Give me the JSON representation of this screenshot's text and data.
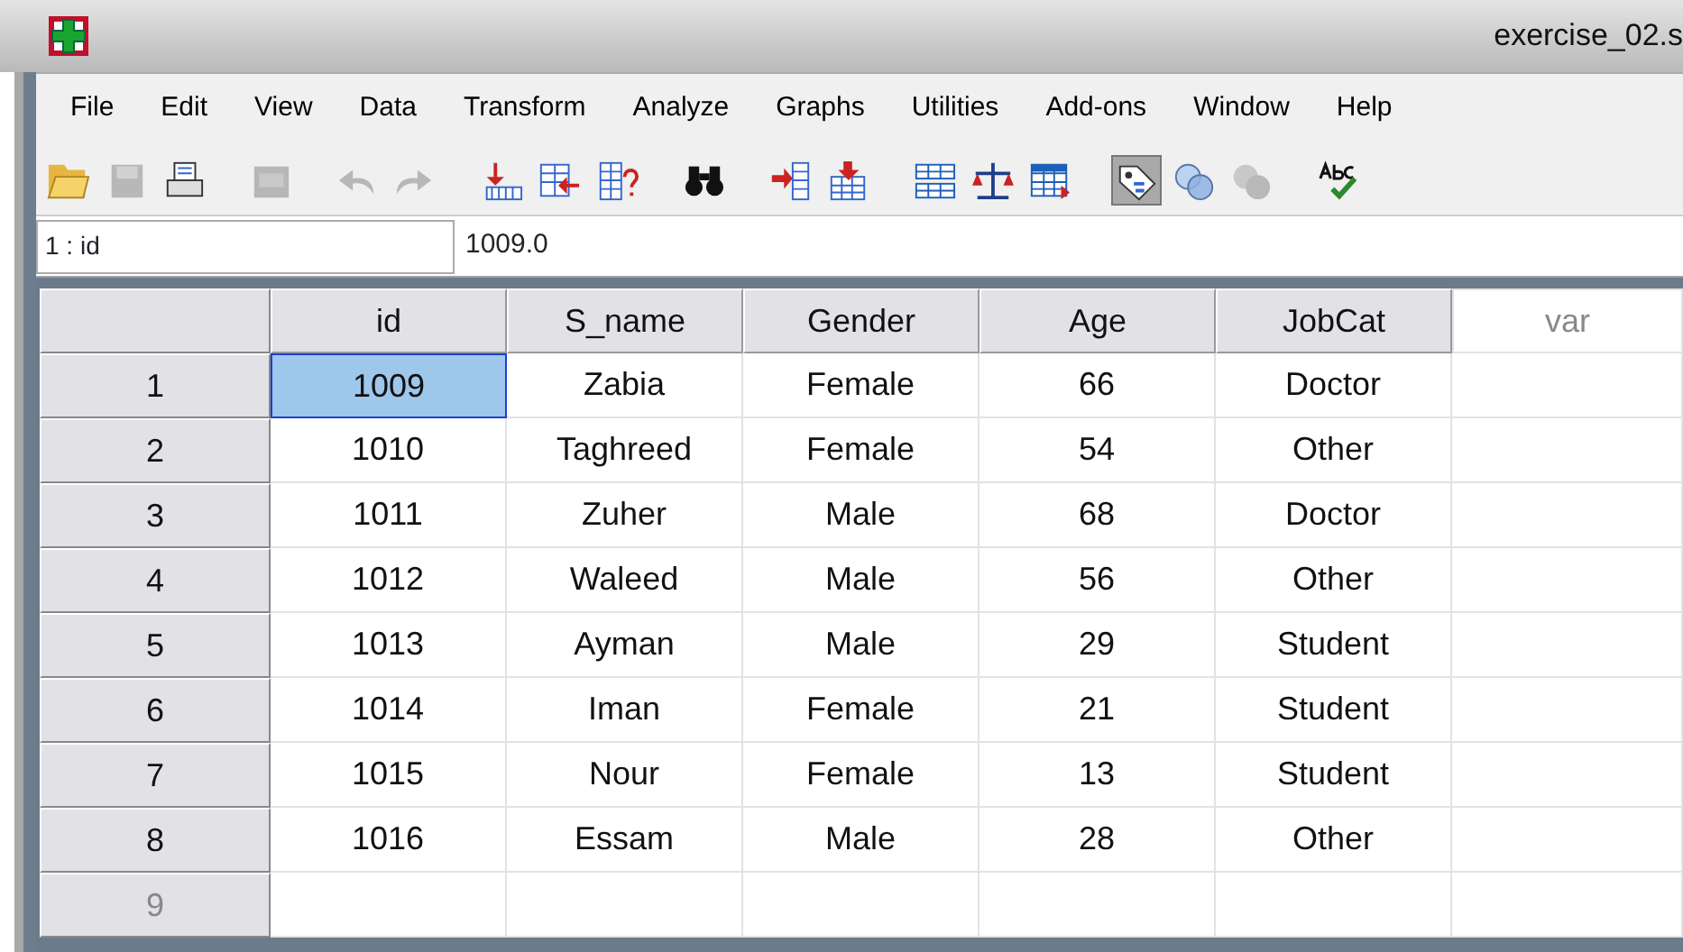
{
  "window": {
    "title": "exercise_02.s"
  },
  "menu": [
    "File",
    "Edit",
    "View",
    "Data",
    "Transform",
    "Analyze",
    "Graphs",
    "Utilities",
    "Add-ons",
    "Window",
    "Help"
  ],
  "toolbar": [
    {
      "kind": "open",
      "disabled": false,
      "pressed": false
    },
    {
      "kind": "save",
      "disabled": true,
      "pressed": false
    },
    {
      "kind": "print",
      "disabled": false,
      "pressed": false
    },
    {
      "kind": "sep"
    },
    {
      "kind": "dialog",
      "disabled": true,
      "pressed": false
    },
    {
      "kind": "sep"
    },
    {
      "kind": "undo",
      "disabled": true,
      "pressed": false
    },
    {
      "kind": "redo",
      "disabled": true,
      "pressed": false
    },
    {
      "kind": "sep"
    },
    {
      "kind": "gotocase",
      "disabled": false,
      "pressed": false
    },
    {
      "kind": "gotovar",
      "disabled": false,
      "pressed": false
    },
    {
      "kind": "varinfo",
      "disabled": false,
      "pressed": false
    },
    {
      "kind": "sep"
    },
    {
      "kind": "find",
      "disabled": false,
      "pressed": false
    },
    {
      "kind": "sep"
    },
    {
      "kind": "inscase",
      "disabled": false,
      "pressed": false
    },
    {
      "kind": "insvar",
      "disabled": false,
      "pressed": false
    },
    {
      "kind": "sep"
    },
    {
      "kind": "split",
      "disabled": false,
      "pressed": false
    },
    {
      "kind": "weight",
      "disabled": false,
      "pressed": false
    },
    {
      "kind": "select",
      "disabled": false,
      "pressed": false
    },
    {
      "kind": "sep"
    },
    {
      "kind": "labels",
      "disabled": false,
      "pressed": true
    },
    {
      "kind": "sets",
      "disabled": false,
      "pressed": false
    },
    {
      "kind": "showall",
      "disabled": true,
      "pressed": false
    },
    {
      "kind": "sep"
    },
    {
      "kind": "spell",
      "disabled": false,
      "pressed": false
    }
  ],
  "cell_editor": {
    "cell": "1 : id",
    "value": "1009.0"
  },
  "columns": [
    {
      "label": "id",
      "kind": "variable"
    },
    {
      "label": "S_name",
      "kind": "variable"
    },
    {
      "label": "Gender",
      "kind": "variable"
    },
    {
      "label": "Age",
      "kind": "variable"
    },
    {
      "label": "JobCat",
      "kind": "variable"
    },
    {
      "label": "var",
      "kind": "empty"
    }
  ],
  "rows": [
    {
      "number": "1",
      "selected": true,
      "empty": false,
      "cells": [
        "1009",
        "Zabia",
        "Female",
        "66",
        "Doctor"
      ]
    },
    {
      "number": "2",
      "selected": false,
      "empty": false,
      "cells": [
        "1010",
        "Taghreed",
        "Female",
        "54",
        "Other"
      ]
    },
    {
      "number": "3",
      "selected": false,
      "empty": false,
      "cells": [
        "1011",
        "Zuher",
        "Male",
        "68",
        "Doctor"
      ]
    },
    {
      "number": "4",
      "selected": false,
      "empty": false,
      "cells": [
        "1012",
        "Waleed",
        "Male",
        "56",
        "Other"
      ]
    },
    {
      "number": "5",
      "selected": false,
      "empty": false,
      "cells": [
        "1013",
        "Ayman",
        "Male",
        "29",
        "Student"
      ]
    },
    {
      "number": "6",
      "selected": false,
      "empty": false,
      "cells": [
        "1014",
        "Iman",
        "Female",
        "21",
        "Student"
      ]
    },
    {
      "number": "7",
      "selected": false,
      "empty": false,
      "cells": [
        "1015",
        "Nour",
        "Female",
        "13",
        "Student"
      ]
    },
    {
      "number": "8",
      "selected": false,
      "empty": false,
      "cells": [
        "1016",
        "Essam",
        "Male",
        "28",
        "Other"
      ]
    },
    {
      "number": "9",
      "selected": false,
      "empty": true
    }
  ]
}
